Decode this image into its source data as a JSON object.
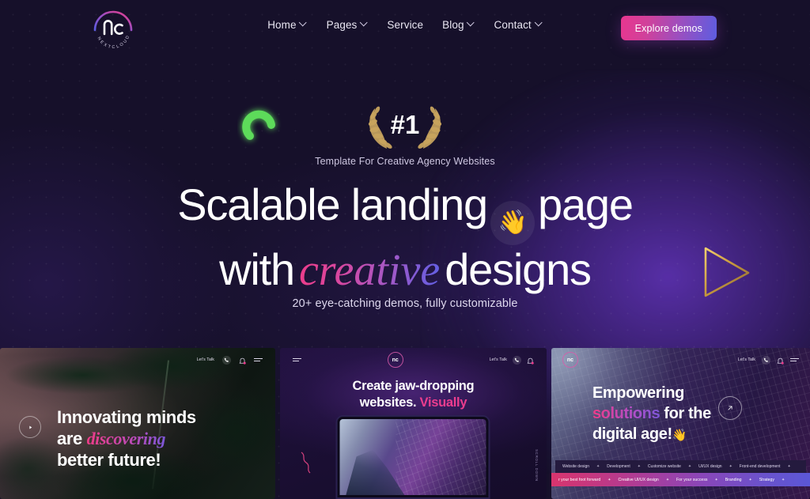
{
  "brand": {
    "logo_mark": "nc",
    "logo_word": "NEXTCLOUD",
    "accent_pink": "#ef3b87",
    "accent_purple": "#5d5de0",
    "accent_gold": "#d9a845",
    "accent_green": "#5ddb5a",
    "bg_dark": "#16102a"
  },
  "header": {
    "nav": [
      {
        "label": "Home",
        "has_chevron": true
      },
      {
        "label": "Pages",
        "has_chevron": true
      },
      {
        "label": "Service",
        "has_chevron": false
      },
      {
        "label": "Blog",
        "has_chevron": true
      },
      {
        "label": "Contact",
        "has_chevron": true
      }
    ],
    "cta_label": "Explore demos"
  },
  "hero": {
    "badge_number": "#1",
    "badge_subtitle": "Template For Creative Agency Websites",
    "title_part1": "Scalable landing",
    "title_emoji": "👋",
    "title_part2": "page",
    "title_line2_pre": "with",
    "title_line2_em": "creative",
    "title_line2_post": "designs",
    "subtitle": "20+ eye-catching demos, fully customizable"
  },
  "cards": [
    {
      "id": "innovating-minds",
      "topbar": {
        "lets_talk": "Let's Talk",
        "phone_icon": "phone-icon",
        "bell_icon": "bell-icon",
        "menu_icon": "hamburger-icon"
      },
      "heading_line1": "Innovating minds",
      "heading_line2_pre": "are",
      "heading_line2_em": "discovering",
      "heading_line3": "better future!",
      "play_icon": "play-icon"
    },
    {
      "id": "jaw-dropping",
      "topbar": {
        "menu_icon": "hamburger-icon",
        "logo_mark": "nc",
        "lets_talk": "Let's Talk",
        "phone_icon": "phone-icon",
        "bell_icon": "bell-icon"
      },
      "heading_line1": "Create jaw-dropping",
      "heading_line2_pre": "websites.",
      "heading_line2_em": "Visually",
      "side_label": "SCROLL DOWN"
    },
    {
      "id": "empowering-solutions",
      "topbar": {
        "logo_mark": "nc",
        "lets_talk": "Let's Talk",
        "phone_icon": "phone-icon",
        "bell_icon": "bell-icon",
        "menu_icon": "hamburger-icon"
      },
      "heading_line1": "Empowering",
      "heading_line2_em": "solutions",
      "heading_line2_post": "for the",
      "heading_line3": "digital age!",
      "heading_emoji": "👋",
      "arrow_icon": "arrow-up-right-icon",
      "marquee_top": [
        "Website design",
        "Development",
        "Customize website",
        "UI/UX design",
        "Front-end development"
      ],
      "marquee_bottom": [
        "r your best foot forward",
        "Creative UI/UX design",
        "For your success",
        "Branding",
        "Strategy"
      ],
      "marquee_separator": "✦"
    }
  ],
  "decor": {
    "spinner_icon": "loading-spinner-icon",
    "laurel_icon": "laurel-wreath-icon",
    "play_triangle_icon": "play-triangle-icon"
  }
}
